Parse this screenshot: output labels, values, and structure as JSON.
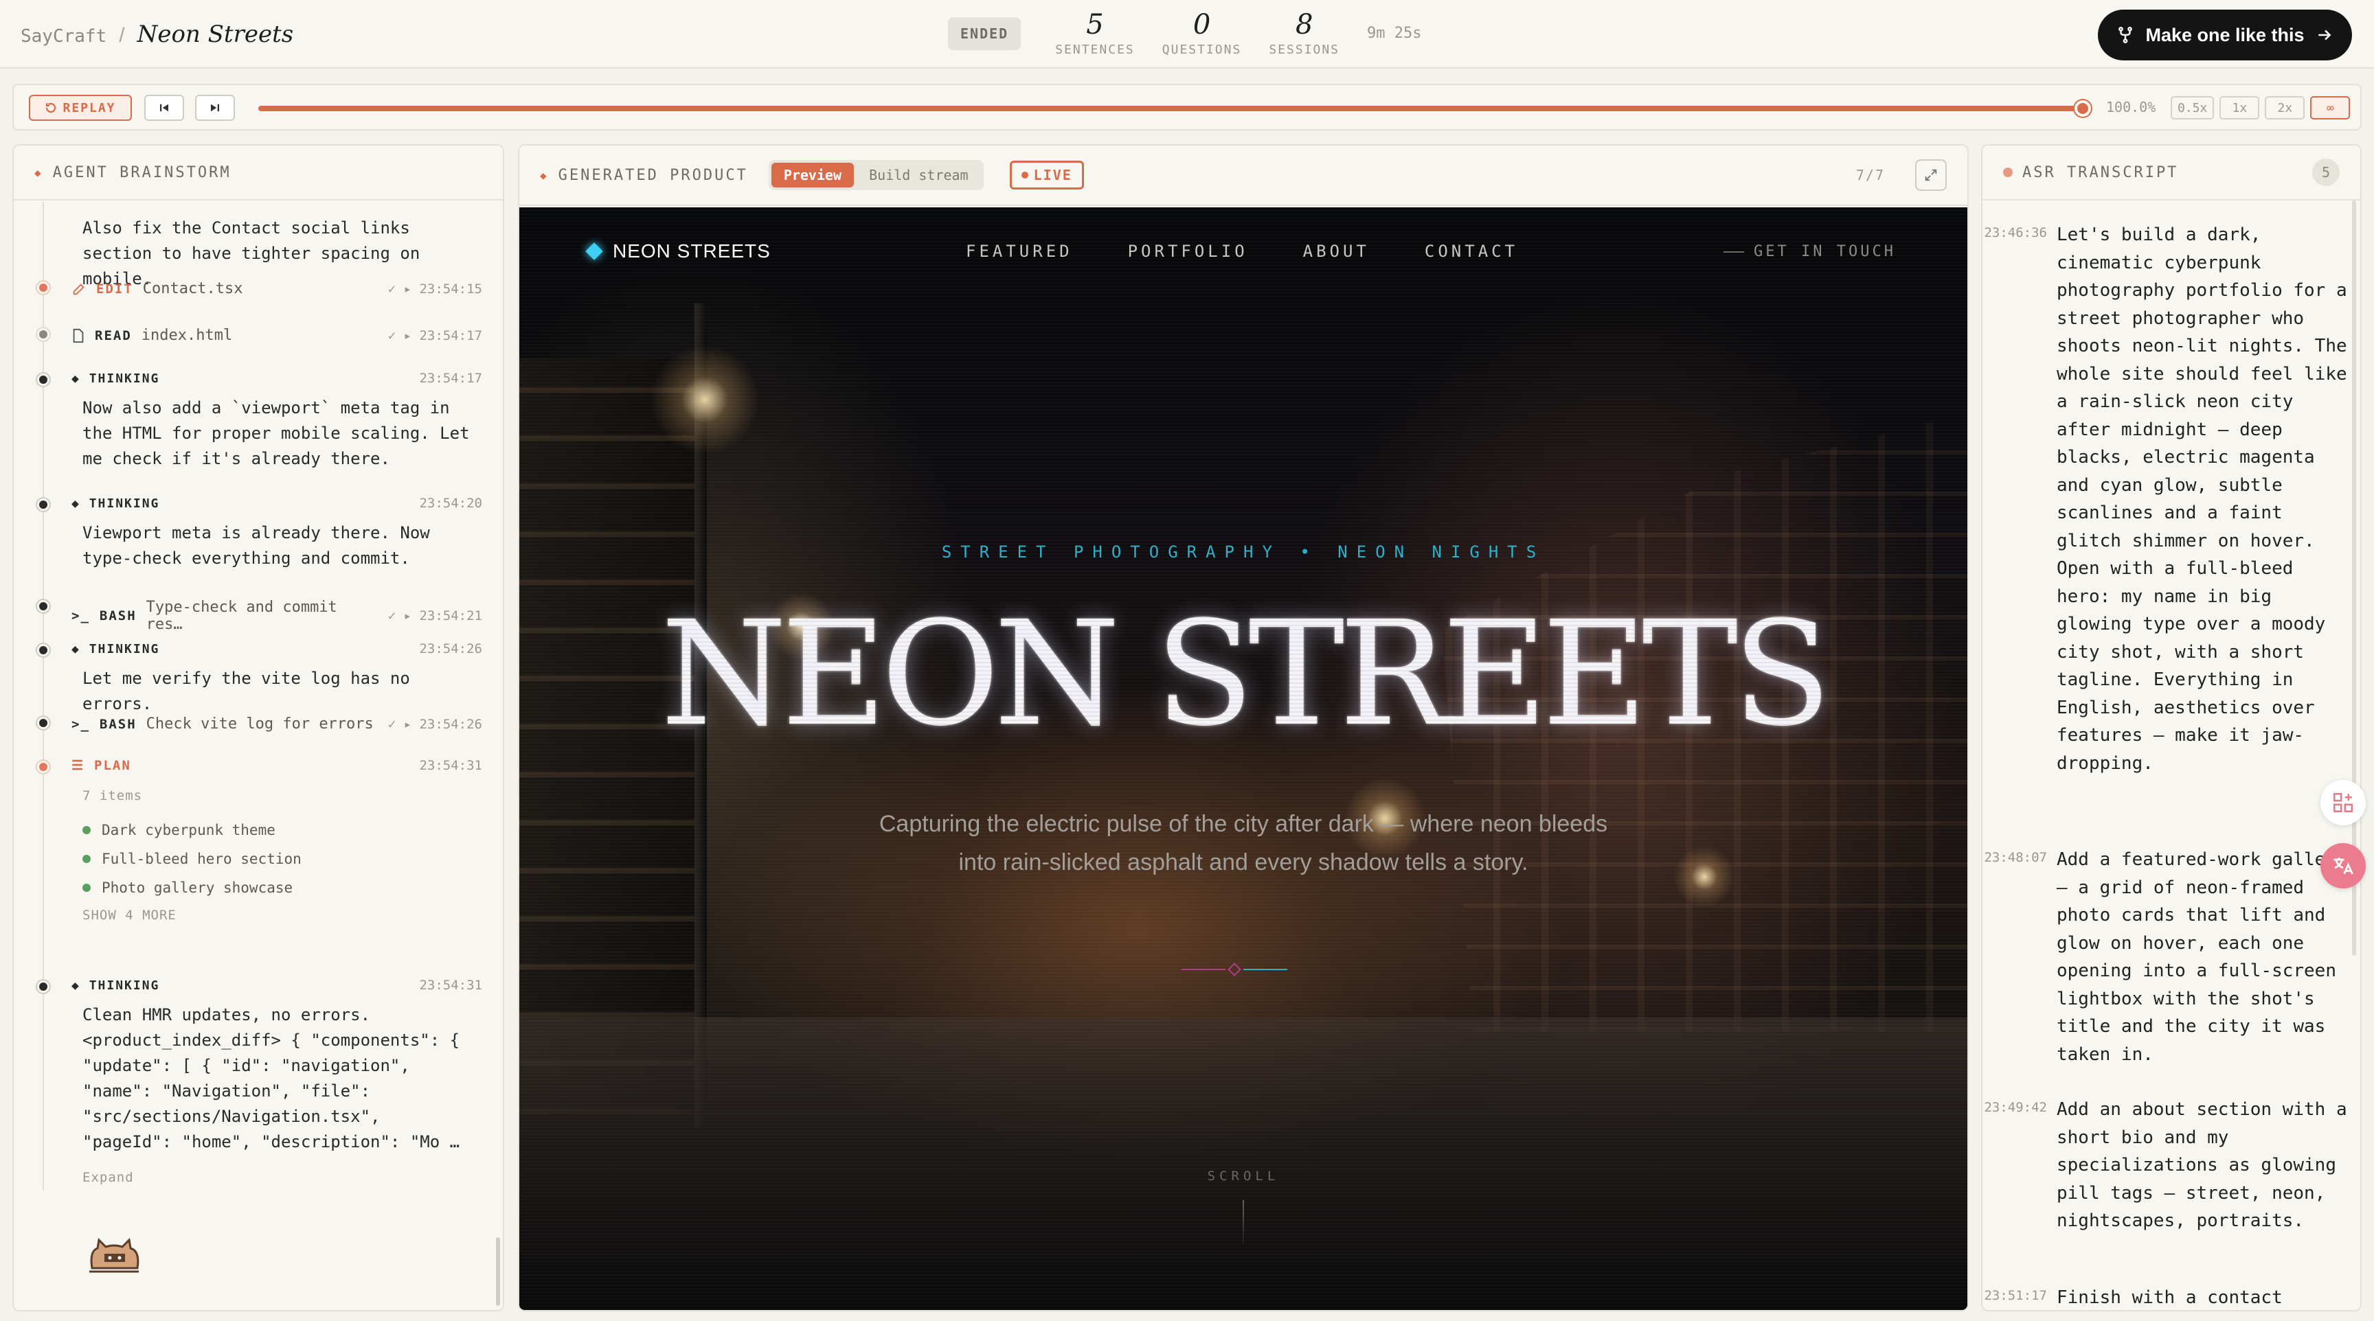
{
  "topbar": {
    "brand": "SayCraft",
    "separator": "/",
    "title": "Neon Streets",
    "status": "ENDED",
    "stats": [
      {
        "value": "5",
        "label": "SENTENCES"
      },
      {
        "value": "0",
        "label": "QUESTIONS"
      },
      {
        "value": "8",
        "label": "SESSIONS"
      }
    ],
    "duration": "9m 25s",
    "cta_label": "Make one like this"
  },
  "replay": {
    "replay_label": "REPLAY",
    "progress_fraction": 1.0,
    "progress_text": "100.0%",
    "speeds": [
      "0.5x",
      "1x",
      "2x",
      "∞"
    ],
    "active_speed": "∞"
  },
  "left_panel": {
    "title": "AGENT BRAINSTORM",
    "entries": {
      "e0_body": "Also fix the Contact social links section to have tighter spacing on mobile.",
      "e1_tag": "EDIT",
      "e1_file": "Contact.tsx",
      "e1_time": "✓ ▸ 23:54:15",
      "e2_tag": "READ",
      "e2_file": "index.html",
      "e2_time": "✓ ▸ 23:54:17",
      "e3_tag": "THINKING",
      "e3_time": "23:54:17",
      "e3_body": "Now also add a `viewport` meta tag in the HTML for proper mobile scaling. Let me check if it's already there.",
      "e4_tag": "THINKING",
      "e4_time": "23:54:20",
      "e4_body": "Viewport meta is already there. Now type-check everything and commit.",
      "e5_tag": "BASH",
      "e5_file": "Type-check and commit res…",
      "e5_time": "✓ ▸ 23:54:21",
      "e6_tag": "THINKING",
      "e6_time": "23:54:26",
      "e6_body": "Let me verify the vite log has no errors.",
      "e7_tag": "BASH",
      "e7_file": "Check vite log for errors",
      "e7_time": "✓ ▸ 23:54:26",
      "e8_tag": "PLAN",
      "e8_time": "23:54:31",
      "e8_count": "7 items",
      "e8_items": [
        "Dark cyberpunk theme",
        "Full-bleed hero section",
        "Photo gallery showcase"
      ],
      "e8_more": "SHOW 4 MORE",
      "e9_tag": "THINKING",
      "e9_time": "23:54:31",
      "e9_body": "Clean HMR updates, no errors. <product_index_diff> { \"components\": { \"update\": [ { \"id\": \"navigation\", \"name\": \"Navigation\", \"file\": \"src/sections/Navigation.tsx\", \"pageId\": \"home\", \"description\": \"Mo …",
      "e9_expand": "Expand"
    }
  },
  "center_panel": {
    "title": "GENERATED PRODUCT",
    "tabs": [
      "Preview",
      "Build stream"
    ],
    "active_tab": "Preview",
    "live_label": "LIVE",
    "page_counter": "7/7",
    "site": {
      "logo": "NEON STREETS",
      "nav": [
        "FEATURED",
        "PORTFOLIO",
        "ABOUT",
        "CONTACT"
      ],
      "nav_cta": "GET IN TOUCH",
      "kicker": "STREET PHOTOGRAPHY • NEON NIGHTS",
      "headline": "NEON STREETS",
      "subtitle": "Capturing the electric pulse of the city after dark — where neon bleeds into rain-slicked asphalt and every shadow tells a story.",
      "scroll_label": "SCROLL"
    }
  },
  "right_panel": {
    "title": "ASR TRANSCRIPT",
    "count": "5",
    "lines": [
      {
        "time": "23:46:36",
        "text": "Let's build a dark, cinematic cyberpunk photography portfolio for a street photographer who shoots neon-lit nights. The whole site should feel like a rain-slick neon city after midnight — deep blacks, electric magenta and cyan glow, subtle scanlines and a faint glitch shimmer on hover. Open with a full-bleed hero: my name in big glowing type over a moody city shot, with a short tagline. Everything in English, aesthetics over features — make it jaw-dropping."
      },
      {
        "time": "23:48:07",
        "text": "Add a featured-work gallery — a grid of neon-framed photo cards that lift and glow on hover, each one opening into a full-screen lightbox with the shot's title and the city it was taken in."
      },
      {
        "time": "23:49:42",
        "text": "Add an about section with a short bio and my specializations as glowing pill tags — street, neon, nightscapes, portraits."
      },
      {
        "time": "23:51:17",
        "text": "Finish with a contact"
      }
    ]
  },
  "colors": {
    "accent": "#d96a4a",
    "cyan": "#3fd1f5",
    "magenta": "#b23b8a",
    "panel_bg": "#f7f6f1"
  }
}
